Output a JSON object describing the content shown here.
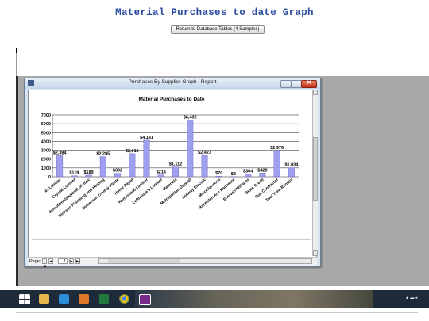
{
  "page": {
    "title": "Material Purchases to date Graph",
    "return_button": "Return to Database Tables (4 Samples)"
  },
  "window": {
    "title": "Purchases By Supplier-Graph : Report",
    "close_glyph": "✕"
  },
  "navigation": {
    "page_label": "Page:",
    "first": "|◀",
    "prev": "◀",
    "page_number": "1",
    "next": "▶",
    "last": "▶|",
    "scroll_left": "◀",
    "scroll_right": "▶"
  },
  "chart_data": {
    "type": "bar",
    "title": "Material Purchases to Date",
    "xlabel": "",
    "ylabel": "",
    "ylim": [
      0,
      7000
    ],
    "yticks": [
      0,
      1000,
      2000,
      3000,
      4000,
      5000,
      6000,
      7000
    ],
    "grid": true,
    "bar_color": "#9f9ff0",
    "categories": [
      "41 Lumber",
      "Crystal Lumber",
      "demolition/disposal of misc",
      "Dickson Plumbing and Heating",
      "Dickerson County Waste",
      "Home Depot",
      "Homestead Lumber",
      "Lofthouse's Lumber",
      "Materials",
      "Metropolitan Drywall",
      "Midway Electric",
      "Miscellaneous",
      "Randolph Ace Hardware",
      "Sherwin-Williams",
      "Store Credit",
      "Sub Contractor",
      "Tool Time Rentals"
    ],
    "values": [
      2384,
      119,
      189,
      2285,
      392,
      2616,
      4141,
      214,
      1112,
      6432,
      2427,
      70,
      8,
      304,
      420,
      2976,
      1034
    ],
    "labels": [
      "$2,384",
      "$119",
      "$189",
      "$2,285",
      "$392",
      "$2,616",
      "$4,141",
      "$214",
      "$1,112",
      "$6,432",
      "$2,427",
      "$70",
      "$8",
      "$304",
      "$420",
      "$2,976",
      "$1,034"
    ]
  },
  "colors": {
    "title_blue": "#2a4aa0",
    "bar_fill": "#9f9ff0",
    "close_red": "#c2301a"
  },
  "taskbar": {
    "icons": [
      "windows-start-icon",
      "file-explorer-icon",
      "media-player-icon",
      "access-icon",
      "excel-icon",
      "chrome-icon",
      "onenote-icon"
    ]
  }
}
